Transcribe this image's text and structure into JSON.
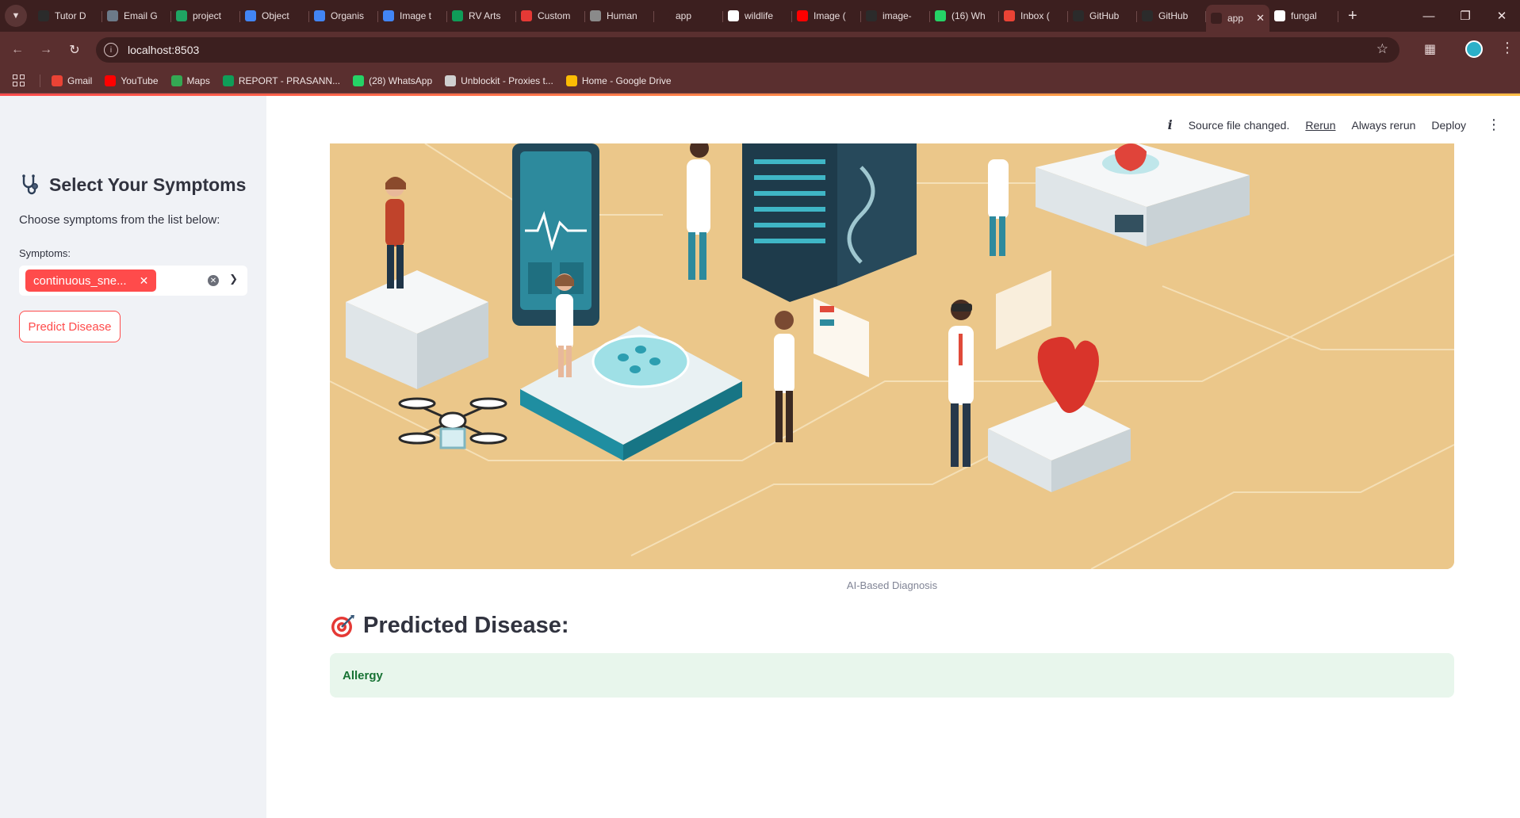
{
  "browser": {
    "tabs": [
      {
        "label": "Tutor D",
        "icon": "tutor-icon",
        "color": "#2b2b2b"
      },
      {
        "label": "Email G",
        "icon": "email-icon",
        "color": "#6c7a89"
      },
      {
        "label": "project",
        "icon": "drive-icon",
        "color": "#1fa463"
      },
      {
        "label": "Object",
        "icon": "docs-icon",
        "color": "#4285f4"
      },
      {
        "label": "Organis",
        "icon": "docs-icon",
        "color": "#4285f4"
      },
      {
        "label": "Image t",
        "icon": "docs-icon",
        "color": "#4285f4"
      },
      {
        "label": "RV Arts",
        "icon": "sheets-icon",
        "color": "#0f9d58"
      },
      {
        "label": "Custom",
        "icon": "l-icon",
        "color": "#e53935"
      },
      {
        "label": "Human",
        "icon": "globe-icon",
        "color": "#8a8a8a"
      },
      {
        "label": "app",
        "icon": "streamlit-icon",
        "color": "#3c1f1f"
      },
      {
        "label": "wildlife",
        "icon": "google-icon",
        "color": "#ffffff"
      },
      {
        "label": "Image (",
        "icon": "youtube-icon",
        "color": "#ff0000"
      },
      {
        "label": "image-",
        "icon": "github-icon",
        "color": "#2b2b2b"
      },
      {
        "label": "(16) Wh",
        "icon": "whatsapp-icon",
        "color": "#25d366"
      },
      {
        "label": "Inbox (",
        "icon": "gmail-icon",
        "color": "#ea4335"
      },
      {
        "label": "GitHub",
        "icon": "github-icon",
        "color": "#2b2b2b"
      },
      {
        "label": "GitHub",
        "icon": "github-icon",
        "color": "#2b2b2b"
      },
      {
        "label": "app",
        "icon": "streamlit-icon",
        "color": "#3c1f1f",
        "active": true
      },
      {
        "label": "fungal",
        "icon": "google-icon",
        "color": "#ffffff"
      }
    ],
    "url": "localhost:8503",
    "bookmarks": [
      {
        "label": "Gmail",
        "icon": "gmail-icon",
        "color": "#ea4335"
      },
      {
        "label": "YouTube",
        "icon": "youtube-icon",
        "color": "#ff0000"
      },
      {
        "label": "Maps",
        "icon": "maps-icon",
        "color": "#34a853"
      },
      {
        "label": "REPORT - PRASANN...",
        "icon": "sheets-icon",
        "color": "#0f9d58"
      },
      {
        "label": "(28) WhatsApp",
        "icon": "whatsapp-icon",
        "color": "#25d366"
      },
      {
        "label": "Unblockit - Proxies t...",
        "icon": "unblockit-icon",
        "color": "#cfcfcf"
      },
      {
        "label": "Home - Google Drive",
        "icon": "drive-icon",
        "color": "#fbbc04"
      }
    ]
  },
  "app": {
    "toolbar": {
      "status": "Source file changed.",
      "rerun": "Rerun",
      "always_rerun": "Always rerun",
      "deploy": "Deploy"
    },
    "sidebar": {
      "title": "Select Your Symptoms",
      "subtitle": "Choose symptoms from the list below:",
      "symptoms_label": "Symptoms:",
      "selected_symptoms": [
        "continuous_sne..."
      ],
      "predict_button": "Predict Disease"
    },
    "main": {
      "image_caption": "AI-Based Diagnosis",
      "predicted_heading": "Predicted Disease:",
      "predicted_value": "Allergy"
    },
    "colors": {
      "primary": "#ff4b4b",
      "sidebar_bg": "#f0f2f6",
      "success_bg": "#e8f6ec",
      "success_text": "#177233",
      "chrome_dark": "#3c1f1f",
      "chrome_mid": "#5a2f2f",
      "illustration_bg": "#ebc78a"
    }
  }
}
